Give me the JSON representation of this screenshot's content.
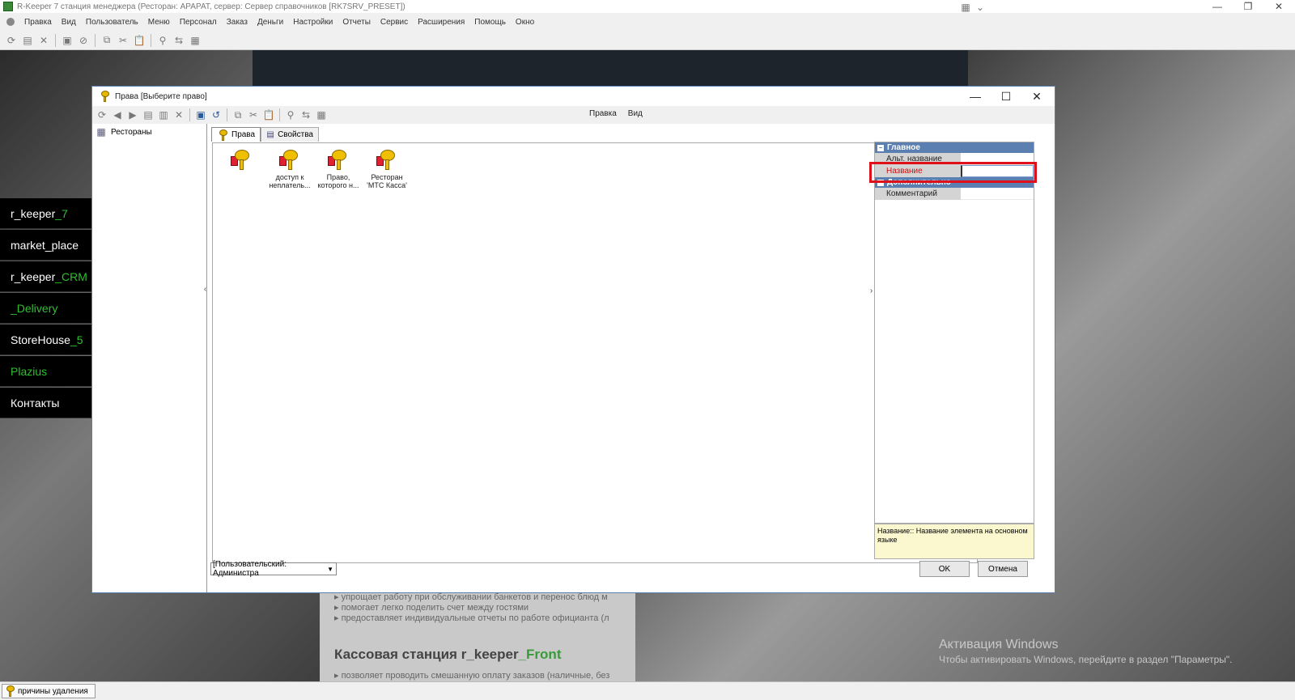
{
  "app": {
    "title": "R-Keeper 7 станция менеджера (Ресторан: АРАРАТ, сервер: Сервер справочников [RK7SRV_PRESET])",
    "menu": [
      "Правка",
      "Вид",
      "Пользователь",
      "Меню",
      "Персонал",
      "Заказ",
      "Деньги",
      "Настройки",
      "Отчеты",
      "Сервис",
      "Расширения",
      "Помощь",
      "Окно"
    ]
  },
  "background": {
    "nav_items": [
      {
        "base": "r_keeper",
        "accent": "_7"
      },
      {
        "base": "market_place",
        "accent": ""
      },
      {
        "base": "r_keeper",
        "accent": "_CRM"
      },
      {
        "base": "",
        "accent": "_Delivery"
      },
      {
        "base": "StoreHouse",
        "accent": "_5"
      },
      {
        "base": "",
        "accent": "Plazius"
      },
      {
        "base": "Контакты",
        "accent": ""
      }
    ],
    "bullets_top": [
      "упрощает работу при обслуживании банкетов и перенос блюд м",
      "помогает легко поделить счет между гостями",
      "предоставляет индивидуальные отчеты по работе официанта (л"
    ],
    "heading_base": "Кассовая станция r_keeper",
    "heading_accent": "_Front",
    "bullet_bottom": "позволяет проводить смешанную оплату заказов (наличные, без",
    "watermark_title": "Активация Windows",
    "watermark_text": "Чтобы активировать Windows, перейдите в раздел \"Параметры\"."
  },
  "taskbar": {
    "item": "причины удаления"
  },
  "dialog": {
    "title": "Права [Выберите право]",
    "menu": [
      "Правка",
      "Вид"
    ],
    "tree_root": "Рестораны",
    "tabs": [
      "Права",
      "Свойства"
    ],
    "items": [
      {
        "label": ""
      },
      {
        "label": "доступ к неплатель..."
      },
      {
        "label": "Право, которого н..."
      },
      {
        "label": "Ресторан 'МТС Касса'"
      }
    ],
    "props": {
      "cat_main": "Главное",
      "row_alt": "Альт. название",
      "row_name": "Название",
      "cat_extra": "Дополнительно",
      "row_comment": "Комментарий"
    },
    "description": "Название:: Название элемента на основном языке",
    "user_select": "[Пользовательский: Администра",
    "ok": "OK",
    "cancel": "Отмена"
  }
}
